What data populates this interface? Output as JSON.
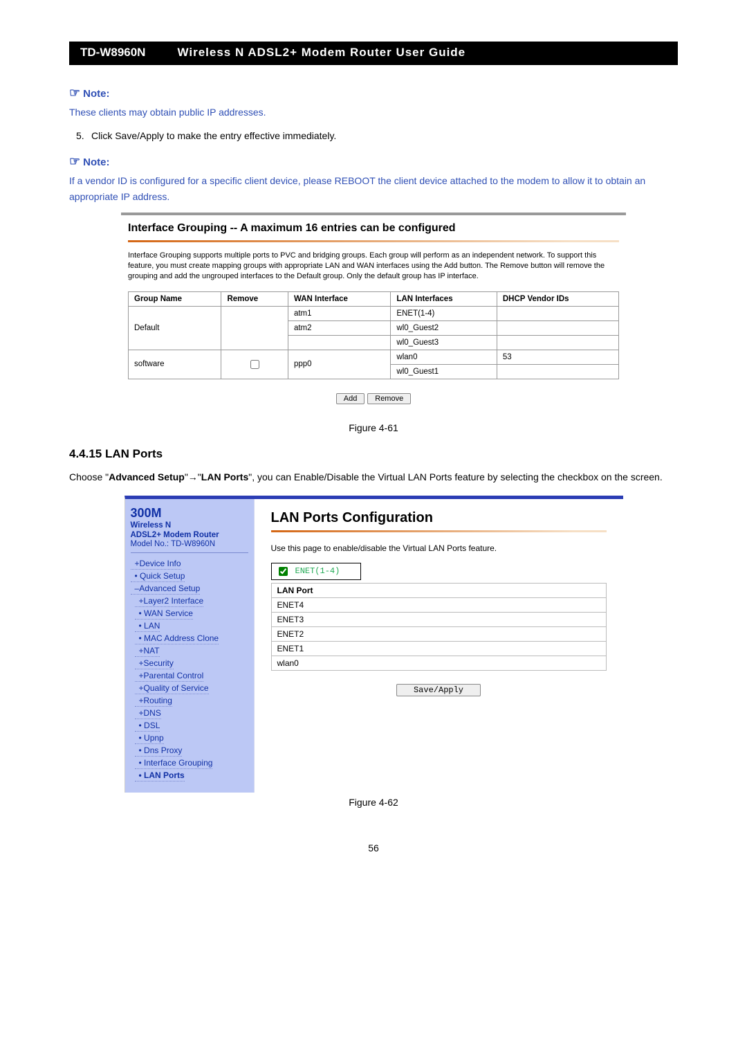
{
  "header": {
    "model": "TD-W8960N",
    "title": "Wireless N ADSL2+ Modem Router User Guide"
  },
  "note_label": "Note:",
  "note1_text": "These clients may obtain public IP addresses.",
  "step5_num": "5.",
  "step5_text": "Click Save/Apply to make the entry effective immediately.",
  "note2_text": "If a vendor ID is configured for a specific client device, please REBOOT the client device attached to the modem to allow it to obtain an appropriate IP address.",
  "fig1": {
    "title": "Interface Grouping -- A maximum 16 entries can be configured",
    "desc": "Interface Grouping supports multiple ports to PVC and bridging groups. Each group will perform as an independent network. To support this feature, you must create mapping groups with appropriate LAN and WAN interfaces using the Add button. The Remove button will remove the grouping and add the ungrouped interfaces to the Default group. Only the default group has IP interface.",
    "headers": [
      "Group Name",
      "Remove",
      "WAN Interface",
      "LAN Interfaces",
      "DHCP Vendor IDs"
    ],
    "rows": [
      {
        "group": "Default",
        "remove": "",
        "wan": "atm1",
        "lan": "ENET(1-4)",
        "vendor": ""
      },
      {
        "group": "",
        "remove": "",
        "wan": "atm2",
        "lan": "wl0_Guest2",
        "vendor": ""
      },
      {
        "group": "",
        "remove": "",
        "wan": "",
        "lan": "wl0_Guest3",
        "vendor": ""
      },
      {
        "group": "software",
        "remove": "checkbox",
        "wan": "ppp0",
        "lan": "wlan0",
        "vendor": "53"
      },
      {
        "group": "",
        "remove": "",
        "wan": "",
        "lan": "wl0_Guest1",
        "vendor": ""
      }
    ],
    "add_btn": "Add",
    "remove_btn": "Remove",
    "caption": "Figure 4-61"
  },
  "section": {
    "num": "4.4.15",
    "title": "LAN Ports"
  },
  "section_intro_pre": "Choose \"",
  "section_intro_b1": "Advanced Setup",
  "section_intro_mid": "\"→\"",
  "section_intro_b2": "LAN Ports",
  "section_intro_post": "\", you can Enable/Disable the Virtual LAN Ports feature by selecting the checkbox on the screen.",
  "device": {
    "brand": "300M",
    "brand_sub1": "Wireless N",
    "brand_sub2": "ADSL2+ Modem Router",
    "brand_model": "Model No.: TD-W8960N",
    "nav": [
      {
        "label": "Device Info",
        "cls": "plus"
      },
      {
        "label": "Quick Setup",
        "cls": "bullet"
      },
      {
        "label": "Advanced Setup",
        "cls": "minus"
      },
      {
        "label": "Layer2 Interface",
        "cls": "plus sub"
      },
      {
        "label": "WAN Service",
        "cls": "bullet sub"
      },
      {
        "label": "LAN",
        "cls": "bullet sub"
      },
      {
        "label": "MAC Address Clone",
        "cls": "bullet sub"
      },
      {
        "label": "NAT",
        "cls": "plus sub"
      },
      {
        "label": "Security",
        "cls": "plus sub"
      },
      {
        "label": "Parental Control",
        "cls": "plus sub"
      },
      {
        "label": "Quality of Service",
        "cls": "plus sub"
      },
      {
        "label": "Routing",
        "cls": "plus sub"
      },
      {
        "label": "DNS",
        "cls": "plus sub"
      },
      {
        "label": "DSL",
        "cls": "bullet sub"
      },
      {
        "label": "Upnp",
        "cls": "bullet sub"
      },
      {
        "label": "Dns Proxy",
        "cls": "bullet sub"
      },
      {
        "label": "Interface Grouping",
        "cls": "bullet sub"
      },
      {
        "label": "LAN Ports",
        "cls": "bullet sub selected"
      }
    ],
    "main": {
      "title": "LAN Ports Configuration",
      "desc": "Use this page to enable/disable the Virtual LAN Ports feature.",
      "enet_label": "ENET(1-4)",
      "th": "LAN Port",
      "ports": [
        "ENET4",
        "ENET3",
        "ENET2",
        "ENET1",
        "wlan0"
      ],
      "save": "Save/Apply"
    }
  },
  "fig2_caption": "Figure 4-62",
  "page_number": "56"
}
